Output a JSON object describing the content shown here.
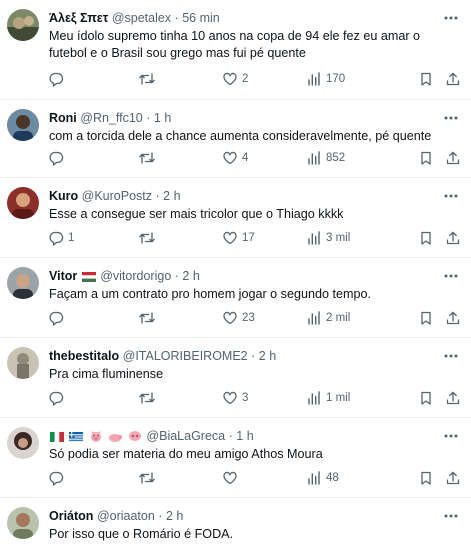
{
  "replies": [
    {
      "name": "Άλεξ Σπετ",
      "handle": "@spetalex",
      "time": "56 min",
      "text": "Meu ídolo  supremo tinha 10 anos na copa de 94 ele fez eu amar o futebol e o Brasil  sou grego mas fui pé  quente",
      "replies": "",
      "retweets": "",
      "likes": "2",
      "views": "170"
    },
    {
      "name": "Roni",
      "handle": "@Rn_ffc10",
      "time": "1 h",
      "text": "com a torcida dele a chance aumenta consideravelmente, pé quente",
      "replies": "",
      "retweets": "",
      "likes": "4",
      "views": "852"
    },
    {
      "name": "Kuro",
      "handle": "@KuroPostz",
      "time": "2 h",
      "text": "Esse a consegue ser mais tricolor que o Thiago kkkk",
      "replies": "1",
      "retweets": "",
      "likes": "17",
      "views": "3 mil"
    },
    {
      "name": "Vitor",
      "handle": "@vitordorigo",
      "time": "2 h",
      "text": "Façam a um contrato pro homem jogar o segundo tempo.",
      "replies": "",
      "retweets": "",
      "likes": "23",
      "views": "2 mil"
    },
    {
      "name": "thebestitalo",
      "handle": "@ITALORIBEIROME2",
      "time": "2 h",
      "text": "Pra cima fluminense",
      "replies": "",
      "retweets": "",
      "likes": "3",
      "views": "1 mil"
    },
    {
      "name": "",
      "handle": "@BiaLaGreca",
      "time": "1 h",
      "text": "Só podia ser materia do meu amigo Athos Moura",
      "replies": "",
      "retweets": "",
      "likes": "",
      "views": "48"
    },
    {
      "name": "Oriáton",
      "handle": "@oriaaton",
      "time": "2 h",
      "text": "Por isso que o Romário é FODA.",
      "replies": "",
      "retweets": "",
      "likes": "",
      "views": ""
    }
  ],
  "separator": "·"
}
